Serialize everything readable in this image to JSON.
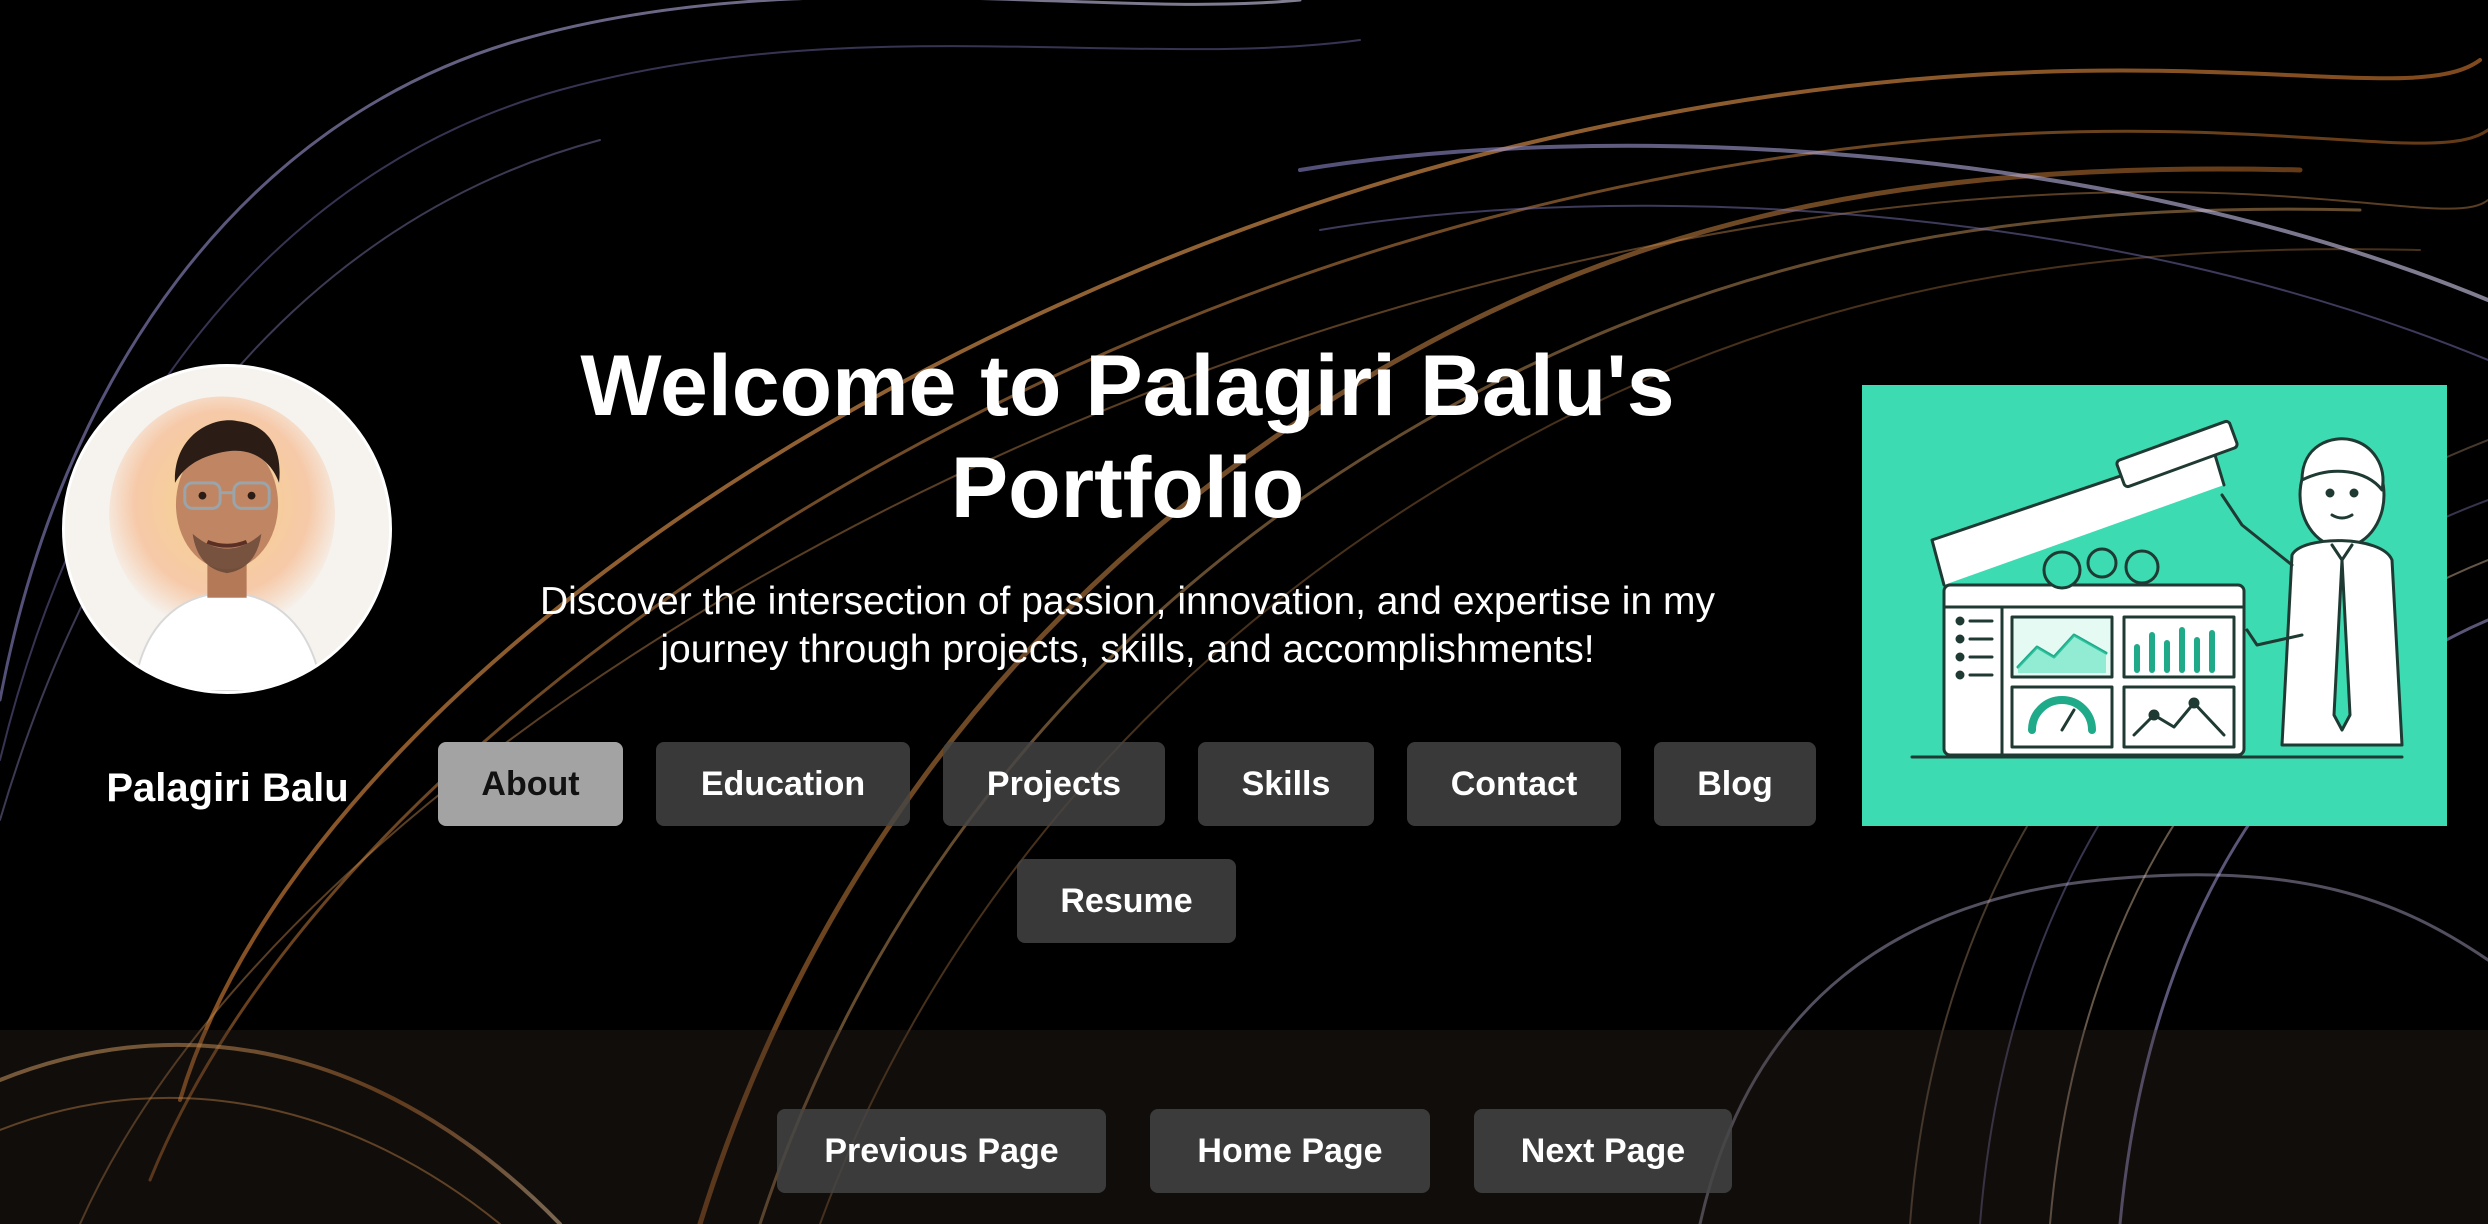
{
  "profile": {
    "name": "Palagiri Balu"
  },
  "hero": {
    "title_line1": "Welcome to Palagiri Balu's",
    "title_line2": "Portfolio",
    "subtitle_line1": "Discover the intersection of passion, innovation, and expertise in my",
    "subtitle_line2": "journey through projects, skills, and accomplishments!"
  },
  "nav": {
    "items": [
      {
        "label": "About",
        "active": true
      },
      {
        "label": "Education",
        "active": false
      },
      {
        "label": "Projects",
        "active": false
      },
      {
        "label": "Skills",
        "active": false
      },
      {
        "label": "Contact",
        "active": false
      },
      {
        "label": "Blog",
        "active": false
      },
      {
        "label": "Resume",
        "active": false
      }
    ]
  },
  "pager": {
    "previous_label": "Previous Page",
    "home_label": "Home Page",
    "next_label": "Next Page"
  },
  "colors": {
    "background": "#000000",
    "button_bg": "#464646",
    "button_active_bg": "#a3a3a3",
    "illustration_bg": "#3ddbb2",
    "swirl_gold": "#d9924a",
    "swirl_lavender": "#8a84c8"
  },
  "images": {
    "avatar": "profile-portrait-illustration",
    "illustration": "dashboard-builder-illustration"
  }
}
